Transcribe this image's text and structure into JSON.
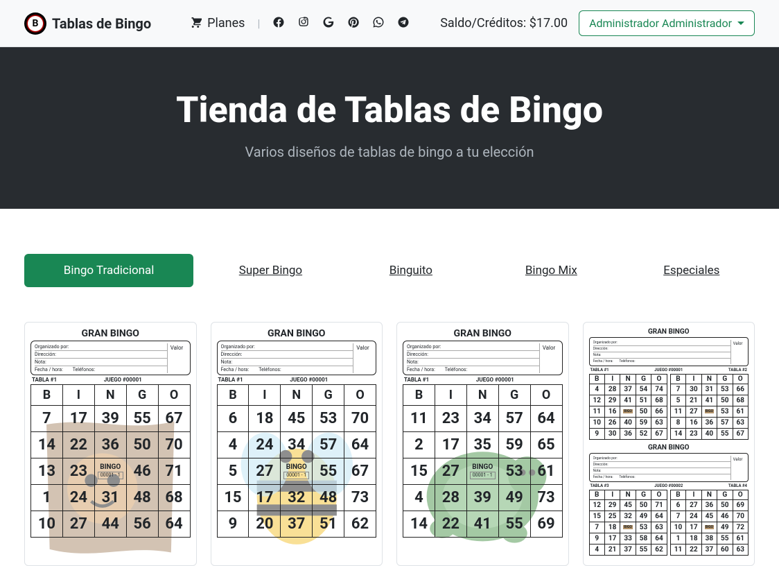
{
  "nav": {
    "brand": "Tablas de Bingo",
    "brand_letter": "B",
    "planes": "Planes",
    "saldo": "Saldo/Créditos: $17.00",
    "admin": "Administrador Administrador"
  },
  "hero": {
    "title": "Tienda de Tablas de Bingo",
    "subtitle": "Varios diseños de tablas de bingo a tu elección"
  },
  "tabs": {
    "t1": "Bingo Tradicional",
    "t2": "Super Bingo",
    "t3": "Binguito",
    "t4": "Bingo Mix",
    "t5": "Especiales"
  },
  "card_common": {
    "title": "GRAN BINGO",
    "organizado": "Organizado por:",
    "direccion": "Dirección:",
    "fecha": "Fecha / hora:",
    "telefonos": "Teléfonos:",
    "nota": "Nota:",
    "valor": "Valor",
    "tabla_lbl": "TABLA #1",
    "tabla2_lbl": "TABLA #2",
    "tabla3_lbl": "TABLA #3",
    "tabla4_lbl": "TABLA #4",
    "juego_lbl": "JUEGO #00001",
    "juego2_lbl": "JUEGO #00002",
    "bingo_word": "BINGO",
    "center_code": "00001 - 1",
    "bigo": "BIGO"
  },
  "headers": [
    "B",
    "I",
    "N",
    "G",
    "O"
  ],
  "card1": {
    "rows": [
      [
        "7",
        "17",
        "39",
        "55",
        "67"
      ],
      [
        "14",
        "22",
        "36",
        "50",
        "70"
      ],
      [
        "13",
        "23",
        "*",
        "46",
        "71"
      ],
      [
        "1",
        "24",
        "31",
        "48",
        "68"
      ],
      [
        "10",
        "27",
        "44",
        "56",
        "64"
      ]
    ]
  },
  "card2": {
    "rows": [
      [
        "6",
        "18",
        "45",
        "53",
        "70"
      ],
      [
        "4",
        "24",
        "34",
        "57",
        "64"
      ],
      [
        "5",
        "27",
        "*",
        "55",
        "67"
      ],
      [
        "15",
        "17",
        "32",
        "48",
        "73"
      ],
      [
        "9",
        "20",
        "37",
        "51",
        "62"
      ]
    ]
  },
  "card3": {
    "rows": [
      [
        "11",
        "23",
        "34",
        "57",
        "64"
      ],
      [
        "2",
        "17",
        "35",
        "59",
        "65"
      ],
      [
        "15",
        "27",
        "*",
        "53",
        "61"
      ],
      [
        "4",
        "28",
        "39",
        "49",
        "73"
      ],
      [
        "14",
        "22",
        "41",
        "55",
        "69"
      ]
    ]
  },
  "card4": {
    "sec1": {
      "left": [
        [
          "4",
          "28",
          "37",
          "54",
          "74"
        ],
        [
          "12",
          "29",
          "41",
          "51",
          "68"
        ],
        [
          "11",
          "16",
          "*",
          "50",
          "66"
        ],
        [
          "10",
          "26",
          "40",
          "59",
          "63"
        ],
        [
          "9",
          "30",
          "36",
          "52",
          "67"
        ]
      ],
      "right": [
        [
          "7",
          "30",
          "31",
          "53",
          "66"
        ],
        [
          "5",
          "21",
          "41",
          "50",
          "68"
        ],
        [
          "11",
          "27",
          "*",
          "53",
          "61"
        ],
        [
          "8",
          "16",
          "36",
          "57",
          "63"
        ],
        [
          "14",
          "23",
          "40",
          "55",
          "67"
        ]
      ]
    },
    "sec2": {
      "left": [
        [
          "12",
          "29",
          "45",
          "50",
          "71"
        ],
        [
          "15",
          "25",
          "32",
          "49",
          "64"
        ],
        [
          "7",
          "18",
          "*",
          "53",
          "63"
        ],
        [
          "9",
          "17",
          "33",
          "58",
          "64"
        ],
        [
          "4",
          "21",
          "37",
          "55",
          "62"
        ]
      ],
      "right": [
        [
          "6",
          "27",
          "36",
          "50",
          "69"
        ],
        [
          "7",
          "24",
          "45",
          "46",
          "70"
        ],
        [
          "10",
          "17",
          "*",
          "49",
          "72"
        ],
        [
          "1",
          "18",
          "38",
          "55",
          "61"
        ],
        [
          "11",
          "22",
          "37",
          "60",
          "63"
        ]
      ]
    }
  }
}
